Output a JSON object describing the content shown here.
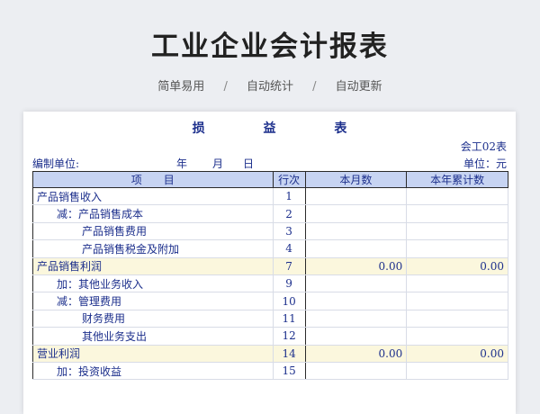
{
  "header": {
    "title": "工业企业会计报表",
    "features": [
      "简单易用",
      "自动统计",
      "自动更新"
    ],
    "separator": "/"
  },
  "sheet": {
    "title_chars": [
      "损",
      "益",
      "表"
    ],
    "code": "会工02表",
    "unit_label": "编制单位:",
    "year": "年",
    "month": "月",
    "day": "日",
    "currency": "单位：元",
    "columns": [
      "项　　目",
      "行次",
      "本月数",
      "本年累计数"
    ],
    "rows": [
      {
        "label": "产品销售收入",
        "line": "1",
        "month": "",
        "ytd": "",
        "indent": 0,
        "highlight": false
      },
      {
        "label": "减：产品销售成本",
        "line": "2",
        "month": "",
        "ytd": "",
        "indent": 1,
        "highlight": false
      },
      {
        "label": "产品销售费用",
        "line": "3",
        "month": "",
        "ytd": "",
        "indent": 2,
        "highlight": false
      },
      {
        "label": "产品销售税金及附加",
        "line": "4",
        "month": "",
        "ytd": "",
        "indent": 2,
        "highlight": false
      },
      {
        "label": "产品销售利润",
        "line": "7",
        "month": "0.00",
        "ytd": "0.00",
        "indent": 0,
        "highlight": true
      },
      {
        "label": "加：其他业务收入",
        "line": "9",
        "month": "",
        "ytd": "",
        "indent": 1,
        "highlight": false
      },
      {
        "label": "减：管理费用",
        "line": "10",
        "month": "",
        "ytd": "",
        "indent": 1,
        "highlight": false
      },
      {
        "label": "财务费用",
        "line": "11",
        "month": "",
        "ytd": "",
        "indent": 2,
        "highlight": false
      },
      {
        "label": "其他业务支出",
        "line": "12",
        "month": "",
        "ytd": "",
        "indent": 2,
        "highlight": false
      },
      {
        "label": "营业利润",
        "line": "14",
        "month": "0.00",
        "ytd": "0.00",
        "indent": 0,
        "highlight": true
      },
      {
        "label": "加：投资收益",
        "line": "15",
        "month": "",
        "ytd": "",
        "indent": 1,
        "highlight": false
      }
    ]
  }
}
